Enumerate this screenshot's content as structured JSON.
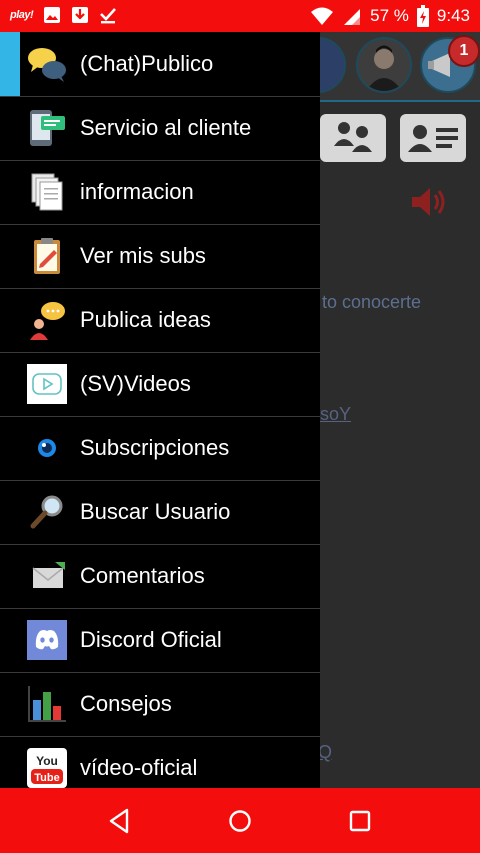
{
  "status_bar": {
    "play_label": "play!",
    "battery_percent": "57 %",
    "time": "9:43"
  },
  "background_app": {
    "notification_count": "1",
    "snippet_text": "to conocerte",
    "link_text_1": "soY",
    "link_text_2": "Q"
  },
  "drawer": {
    "items": [
      {
        "label": "(Chat)Publico",
        "icon": "chat-bubbles-icon",
        "active": true
      },
      {
        "label": "Servicio al cliente",
        "icon": "phone-message-icon"
      },
      {
        "label": "informacion",
        "icon": "documents-icon"
      },
      {
        "label": "Ver mis subs",
        "icon": "clipboard-icon"
      },
      {
        "label": "Publica ideas",
        "icon": "person-idea-icon"
      },
      {
        "label": "(SV)Videos",
        "icon": "video-play-icon"
      },
      {
        "label": "Subscripciones",
        "icon": "eye-icon"
      },
      {
        "label": "Buscar Usuario",
        "icon": "magnifier-icon"
      },
      {
        "label": "Comentarios",
        "icon": "envelope-icon"
      },
      {
        "label": "Discord Oficial",
        "icon": "discord-icon"
      },
      {
        "label": "Consejos",
        "icon": "bar-chart-icon"
      },
      {
        "label": "vídeo-oficial",
        "icon": "youtube-icon"
      }
    ]
  },
  "youtube_icon_text": {
    "top": "You",
    "bottom": "Tube"
  },
  "colors": {
    "status_bar": "#f40d0d",
    "nav_bar": "#f40d0d",
    "drawer_bg": "#000000",
    "active_accent": "#33b5e5",
    "discord": "#7289da"
  }
}
